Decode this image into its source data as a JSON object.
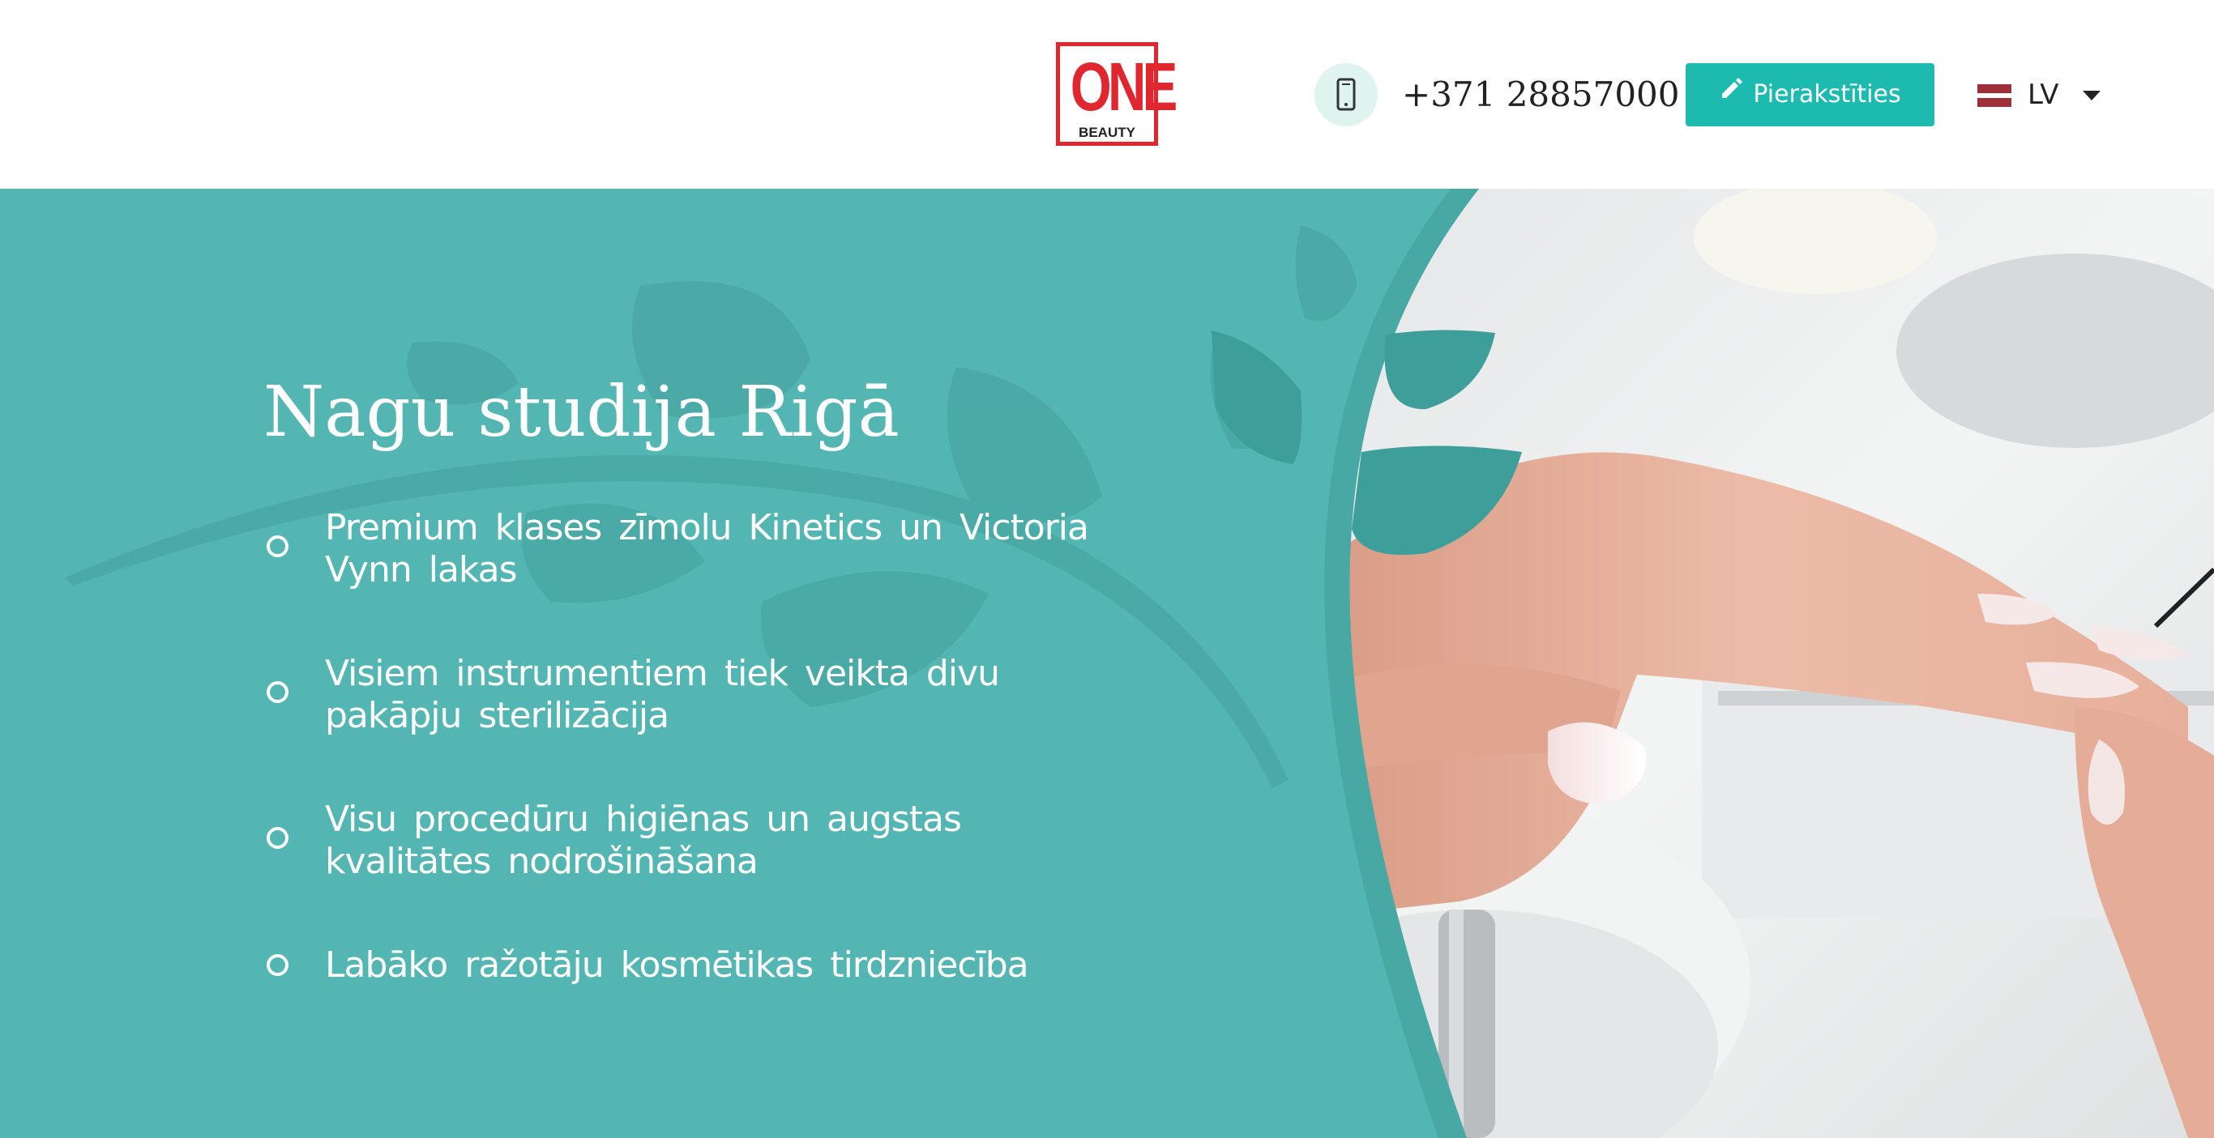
{
  "header": {
    "logo": {
      "text": "ONE",
      "subtext": "BEAUTY",
      "icon": "one-beauty-logo"
    },
    "phone": {
      "icon": "smartphone-icon",
      "number": "+371 28857000"
    },
    "book_button": {
      "icon": "pencil-icon",
      "label": "Pierakstīties"
    },
    "language": {
      "flag": "latvia-flag-icon",
      "code": "LV",
      "caret": "caret-down-icon"
    }
  },
  "hero": {
    "title": "Nagu studija Rigā",
    "features": [
      {
        "line1": "Premium klases zīmolu Kinetics un Victoria",
        "line2": "Vynn lakas"
      },
      {
        "line1": "Visiem instrumentiem tiek veikta divu",
        "line2": "pakāpju sterilizācija"
      },
      {
        "line1": "Visu procedūru higiēnas un augstas",
        "line2": "kvalitātes nodrošināšana"
      },
      {
        "line1": "Labāko ražotāju kosmētikas tirdzniecība",
        "line2": ""
      }
    ],
    "image": "manicure-photo"
  },
  "colors": {
    "teal": "#54b6b2",
    "teal_dark": "#3d9e9a",
    "button": "#1dbab0",
    "logo_red": "#e0262e"
  }
}
